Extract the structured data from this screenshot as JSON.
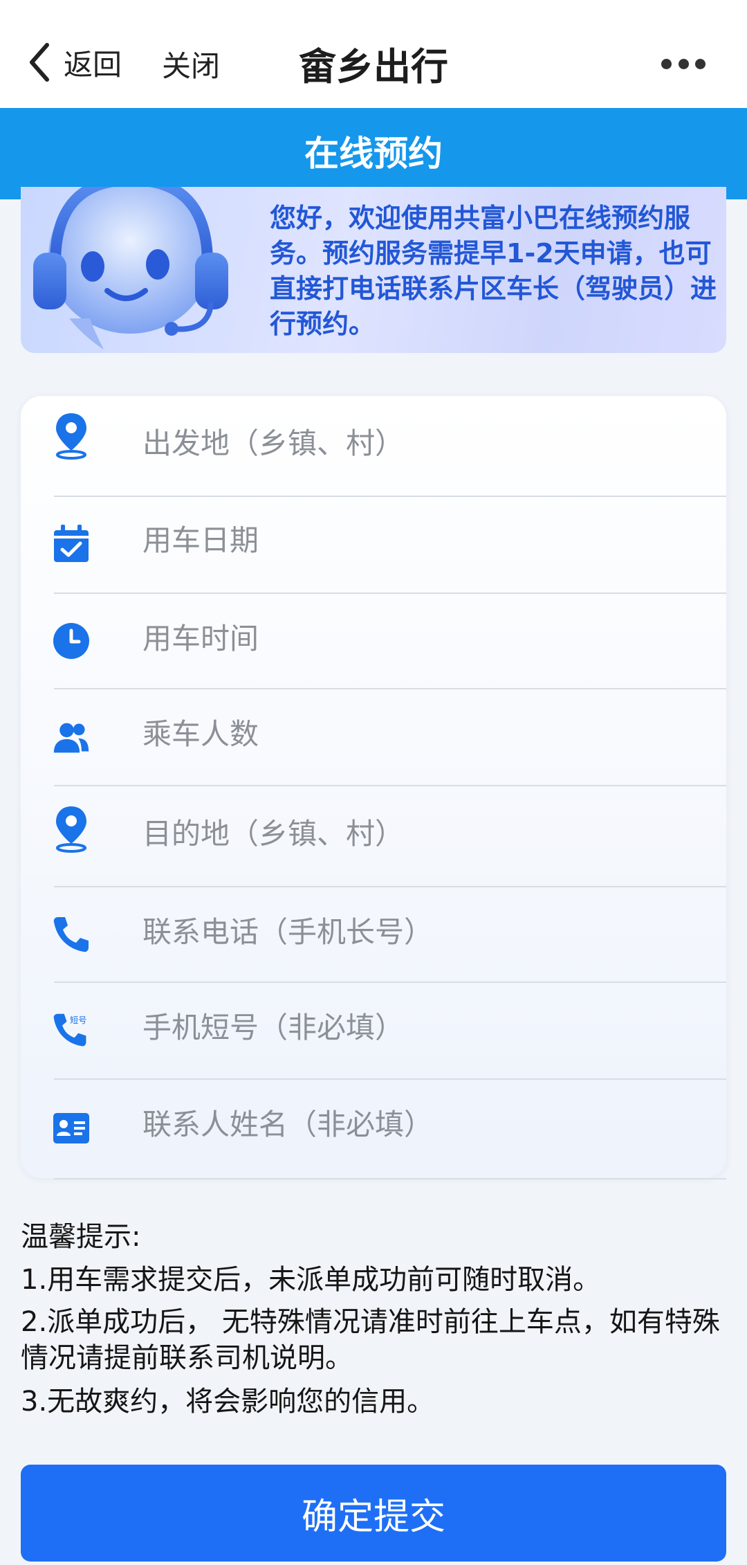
{
  "header": {
    "back_label": "返回",
    "close_label": "关闭",
    "title": "畲乡出行",
    "more_icon": "more-dots-icon"
  },
  "section_title": "在线预约",
  "banner": {
    "message": "您好，欢迎使用共富小巴在线预约服务。预约服务需提早1-2天申请，也可直接打电话联系片区车长（驾驶员）进行预约。"
  },
  "form": {
    "fields": [
      {
        "icon": "location-pin-icon",
        "placeholder": "出发地（乡镇、村）",
        "value": ""
      },
      {
        "icon": "calendar-icon",
        "placeholder": "用车日期",
        "value": ""
      },
      {
        "icon": "clock-icon",
        "placeholder": "用车时间",
        "value": ""
      },
      {
        "icon": "people-icon",
        "placeholder": "乘车人数",
        "value": ""
      },
      {
        "icon": "location-pin-icon",
        "placeholder": "目的地（乡镇、村）",
        "value": ""
      },
      {
        "icon": "phone-icon",
        "placeholder": "联系电话（手机长号）",
        "value": ""
      },
      {
        "icon": "phone-short-number-icon",
        "placeholder": "手机短号（非必填）",
        "value": "",
        "icon_text": "短号"
      },
      {
        "icon": "contact-card-icon",
        "placeholder": "联系人姓名（非必填）",
        "value": ""
      }
    ]
  },
  "tips": {
    "heading": "温馨提示:",
    "items": [
      "1.用车需求提交后，未派单成功前可随时取消。",
      "2.派单成功后， 无特殊情况请准时前往上车点，如有特殊情况请提前联系司机说明。",
      "3.无故爽约，将会影响您的信用。"
    ]
  },
  "submit_label": "确定提交",
  "colors": {
    "accent": "#1e6ff5",
    "header_bar": "#1597ec",
    "banner_text": "#2257d6",
    "icon": "#1a73e8"
  }
}
